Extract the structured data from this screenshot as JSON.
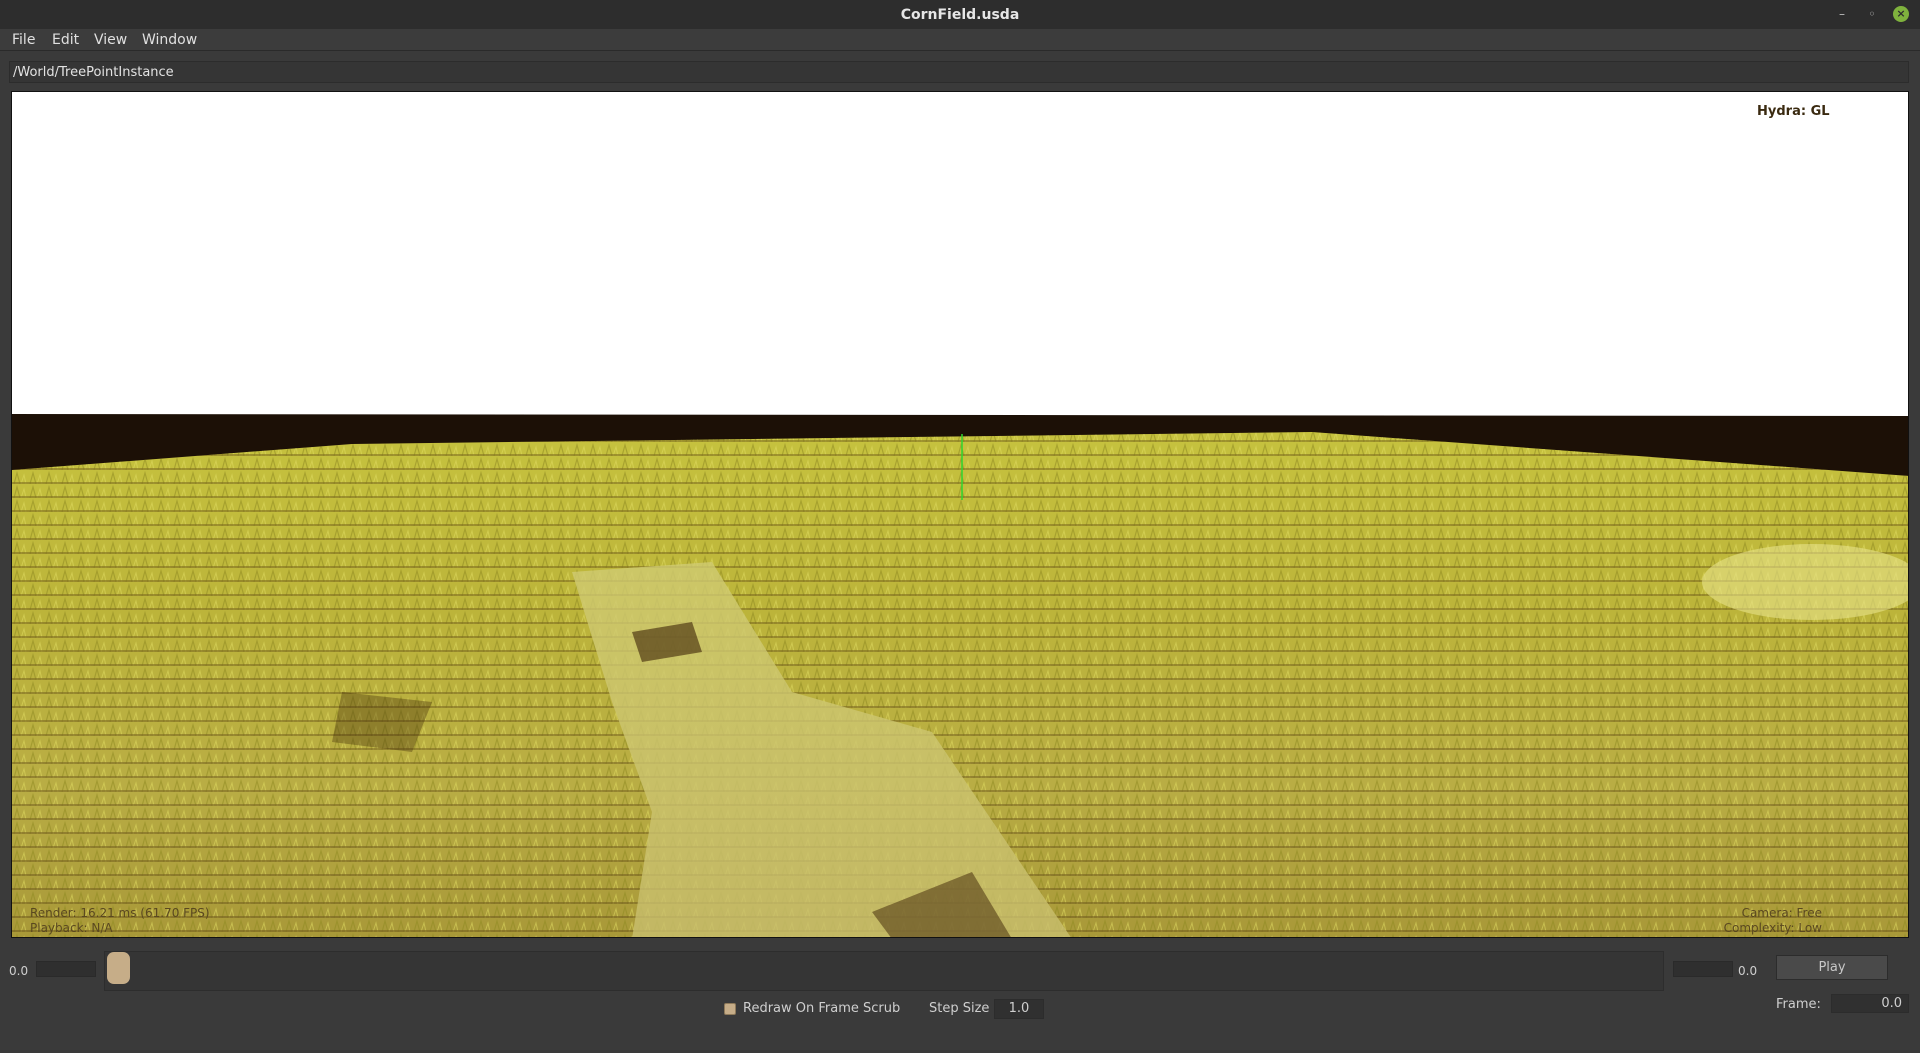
{
  "window": {
    "title": "CornField.usda"
  },
  "menu": {
    "items": [
      "File",
      "Edit",
      "View",
      "Window"
    ]
  },
  "path": {
    "value": "/World/TreePointInstance"
  },
  "viewport": {
    "renderer_label": "Hydra: GL",
    "stats_line1": "Render: 16.21 ms (61.70 FPS)",
    "stats_line2": "Playback: N/A",
    "camera_line1": "Camera: Free",
    "camera_line2": "Complexity: Low"
  },
  "timeline": {
    "start_value": "0.0",
    "end_value": "0.0",
    "play_label": "Play",
    "redraw_label": "Redraw On Frame Scrub",
    "step_label": "Step Size",
    "step_value": "1.0",
    "frame_label": "Frame:",
    "frame_value": "0.0"
  },
  "colors": {
    "corn": "#c9c23a",
    "soil": "#3d2406",
    "sky": "#ffffff",
    "handle": "#c6ad88"
  }
}
